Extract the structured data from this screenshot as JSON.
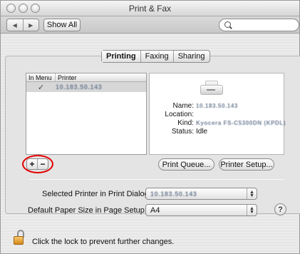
{
  "window": {
    "title": "Print & Fax"
  },
  "toolbar": {
    "back_glyph": "◀",
    "forward_glyph": "▶",
    "show_all_label": "Show All",
    "search_placeholder": ""
  },
  "tabs": [
    {
      "label": "Printing",
      "selected": true
    },
    {
      "label": "Faxing",
      "selected": false
    },
    {
      "label": "Sharing",
      "selected": false
    }
  ],
  "printer_list": {
    "columns": [
      "In Menu",
      "Printer"
    ],
    "rows": [
      {
        "in_menu_mark": "✓",
        "printer": "10.183.50.143"
      }
    ]
  },
  "details": {
    "name_label": "Name:",
    "name_value": "10.183.50.143",
    "location_label": "Location:",
    "location_value": "",
    "kind_label": "Kind:",
    "kind_value": "Kyocera FS-C5300DN (KPDL)",
    "status_label": "Status:",
    "status_value": "Idle"
  },
  "buttons": {
    "add": "+",
    "remove": "−",
    "print_queue": "Print Queue...",
    "printer_setup": "Printer Setup..."
  },
  "form": {
    "selected_printer_label": "Selected Printer in Print Dialog:",
    "selected_printer_value": "10.183.50.143",
    "paper_size_label": "Default Paper Size in Page Setup:",
    "paper_size_value": "A4"
  },
  "help": {
    "glyph": "?"
  },
  "lock": {
    "text": "Click the lock to prevent further changes."
  },
  "colors": {
    "highlight": "#e40000",
    "selection": "#d7d7d7"
  }
}
